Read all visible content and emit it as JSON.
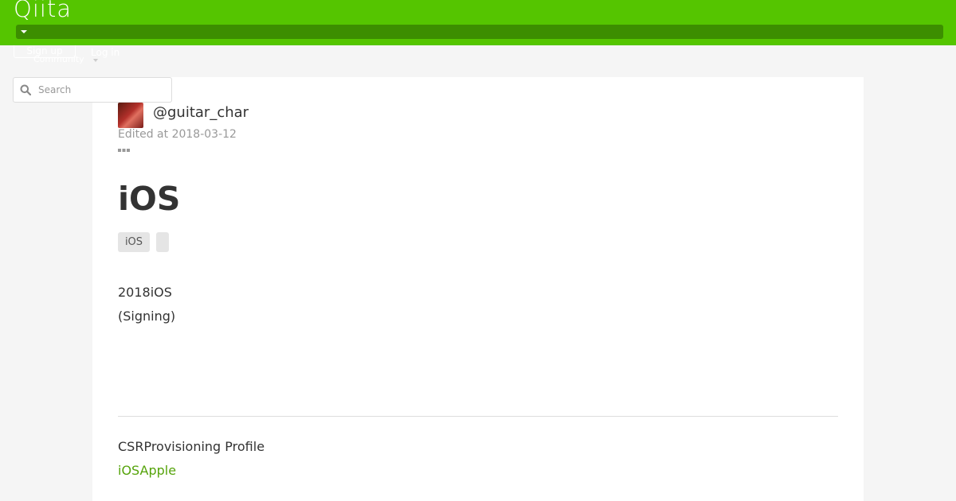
{
  "header": {
    "logo": "Qiita",
    "signup_label": "Sign up",
    "login_label": "Log in",
    "community_label": "Community"
  },
  "search": {
    "placeholder": "Search"
  },
  "article": {
    "author": "@guitar_char",
    "edited": "Edited at 2018-03-12",
    "title": "iOS",
    "tags": [
      "iOS",
      ""
    ],
    "paragraph_1": "2018iOS",
    "paragraph_2": "(Signing)",
    "paragraph_3": "CSRProvisioning Profile",
    "link_1": "iOSApple"
  },
  "colors": {
    "brand": "#55c500",
    "brand_dark": "#3c8e00",
    "link": "#55a30a"
  },
  "icons": {
    "search": "search-icon",
    "more": "more-icon",
    "caret": "chevron-down-icon"
  }
}
